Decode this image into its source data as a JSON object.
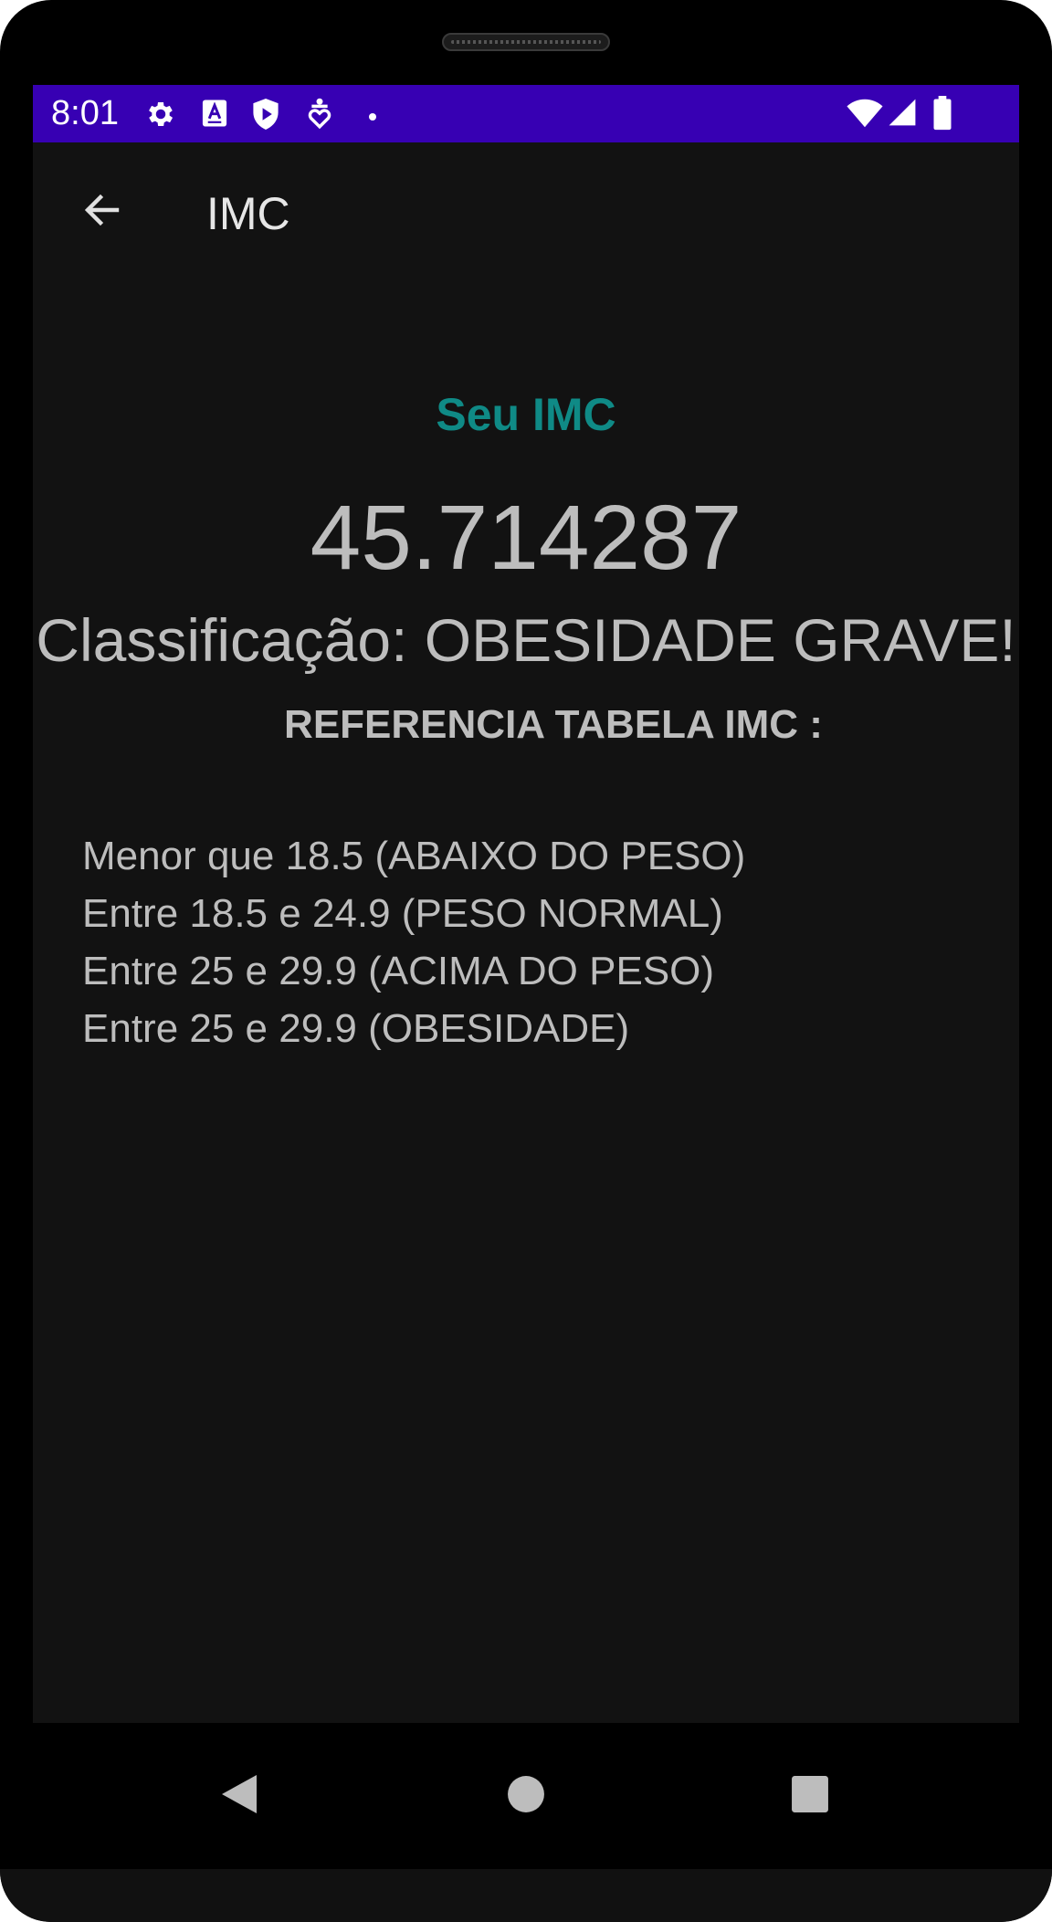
{
  "status_bar": {
    "time": "8:01",
    "background": "#3700b3",
    "left_icons": [
      "settings-gear-icon",
      "text-a-icon",
      "shield-play-icon",
      "accessibility-heart-icon",
      "notification-dot-icon"
    ],
    "right_icons": [
      "wifi-icon",
      "cell-signal-icon",
      "battery-icon"
    ]
  },
  "app_bar": {
    "title": "IMC",
    "back_icon": "arrow-left-icon"
  },
  "result": {
    "heading": "Seu IMC",
    "heading_color": "#0f8a86",
    "value": "45.714287",
    "classification": "Classificação: OBESIDADE GRAVE!"
  },
  "reference": {
    "title": "REFERENCIA TABELA IMC :",
    "items": [
      "Menor que 18.5 (ABAIXO DO PESO)",
      "Entre 18.5 e 24.9 (PESO NORMAL)",
      "Entre 25 e 29.9 (ACIMA DO PESO)",
      "Entre 25 e 29.9 (OBESIDADE)"
    ]
  },
  "nav_bar": {
    "buttons": [
      "back-triangle-icon",
      "home-circle-icon",
      "recents-square-icon"
    ]
  }
}
